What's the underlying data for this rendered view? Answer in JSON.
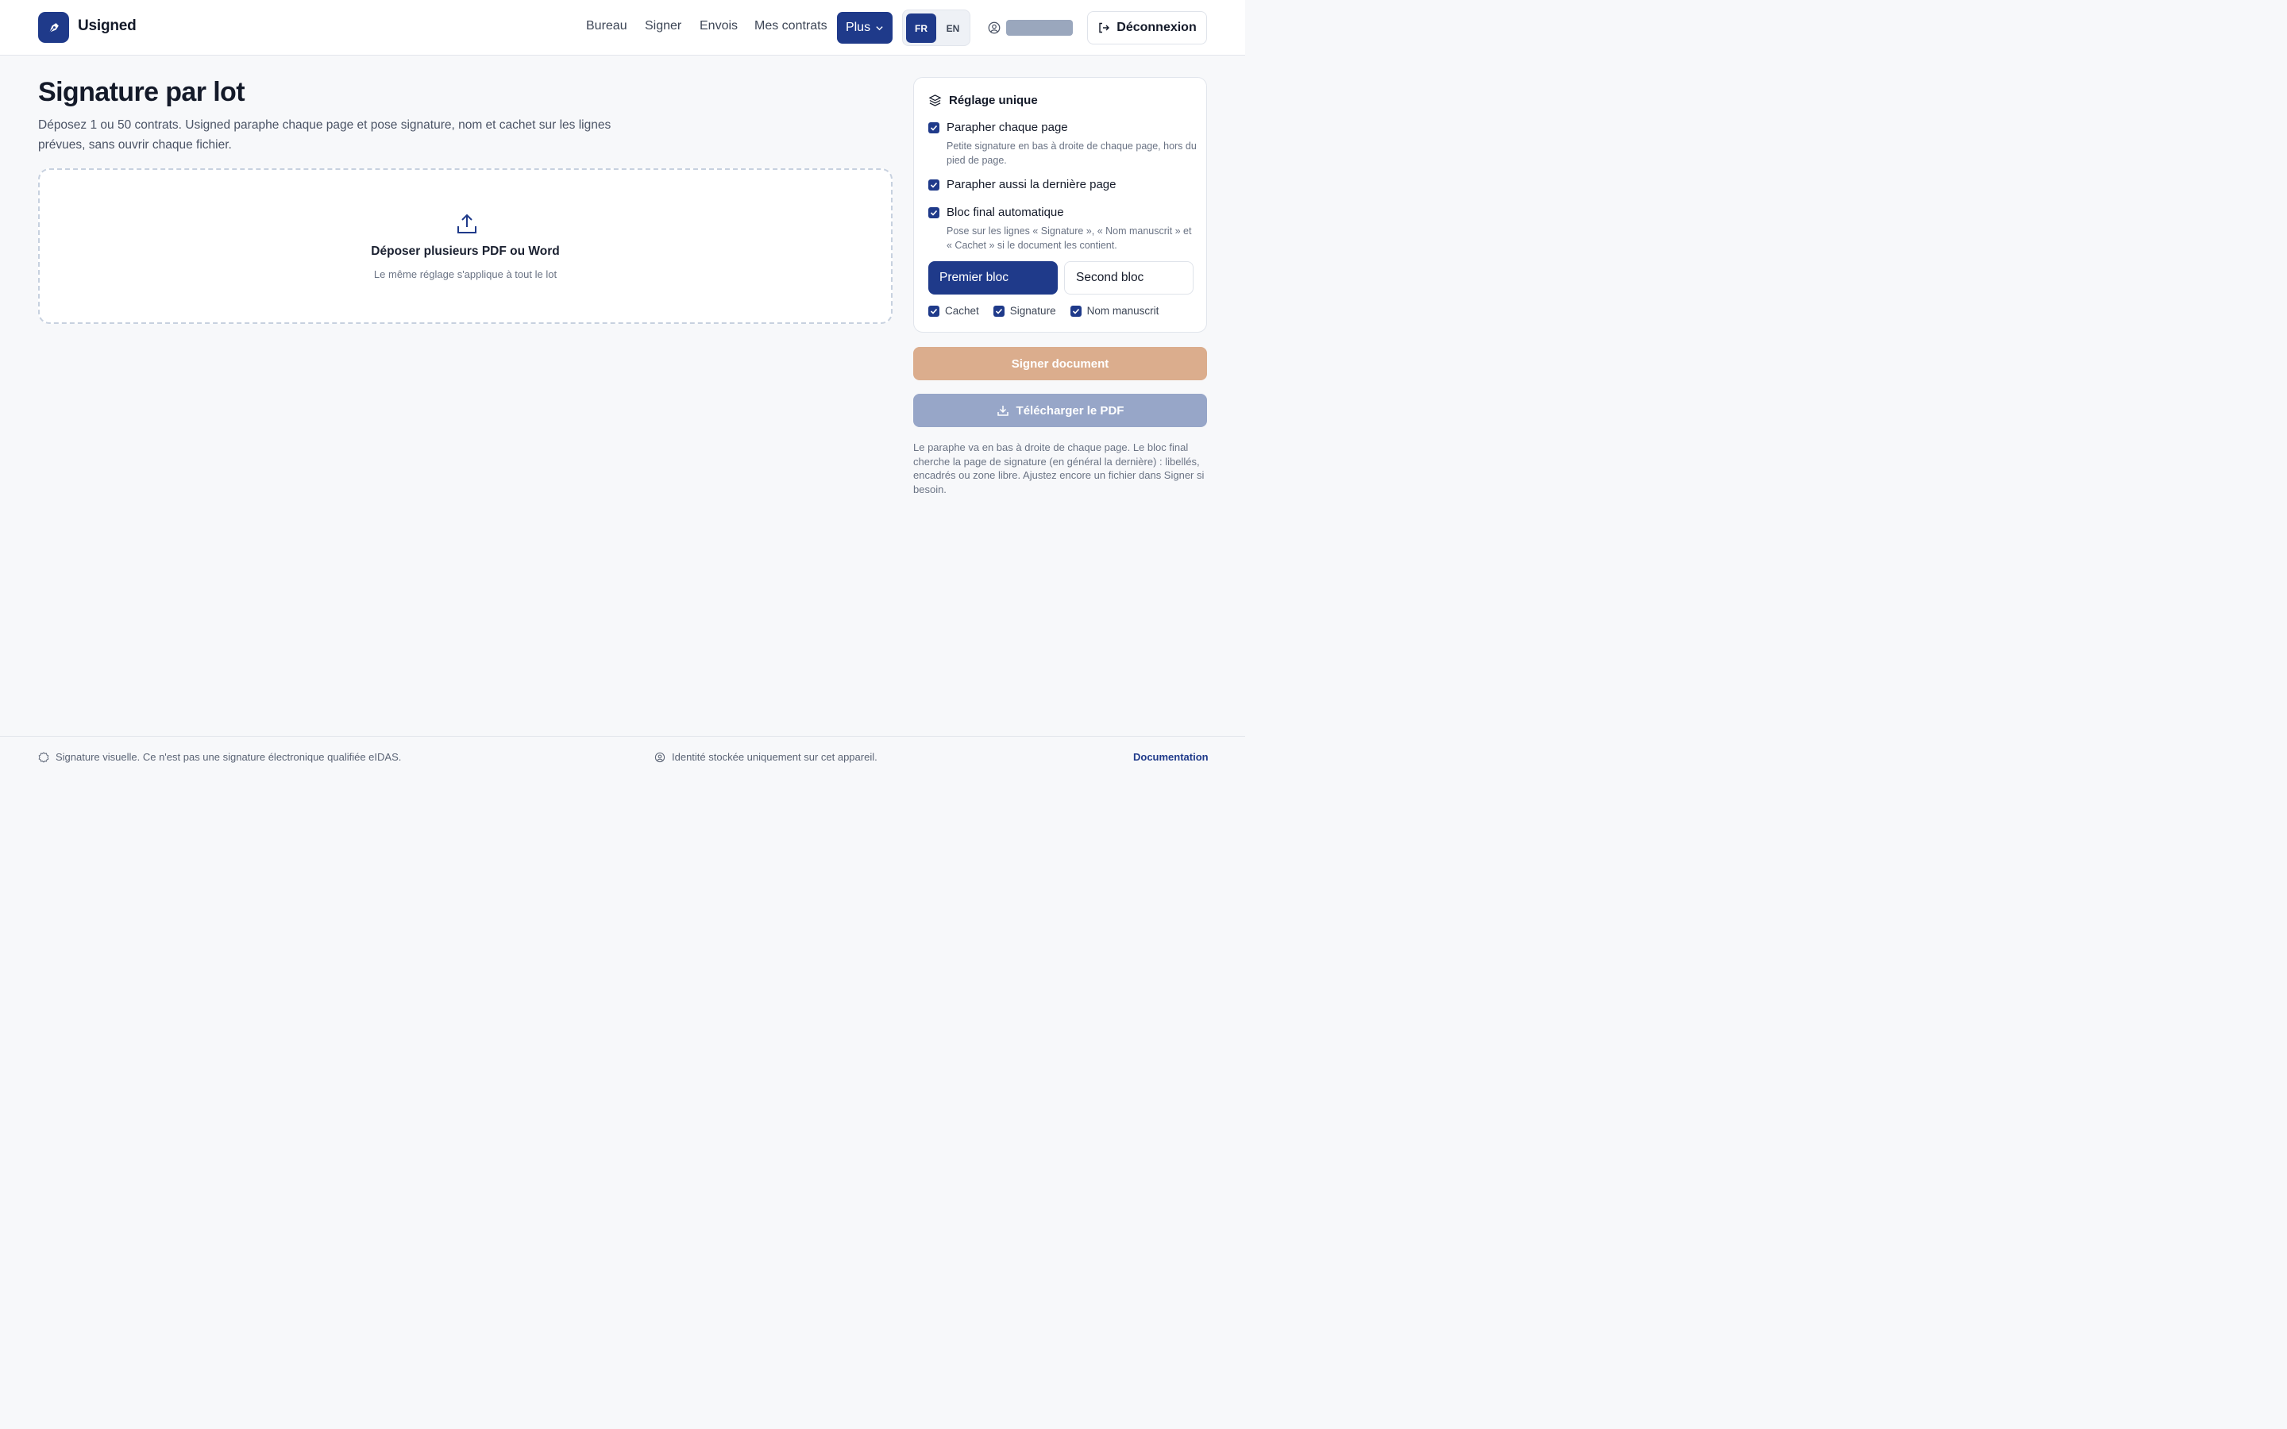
{
  "header": {
    "brand": "Usigned",
    "nav": [
      "Bureau",
      "Signer",
      "Envois",
      "Mes contrats"
    ],
    "more_label": "Plus",
    "lang": {
      "fr": "FR",
      "en": "EN",
      "active": "FR"
    },
    "logout_label": "Déconnexion"
  },
  "main": {
    "title": "Signature par lot",
    "description": "Déposez 1 ou 50 contrats. Usigned paraphe chaque page et pose signature, nom et cachet sur les lignes prévues, sans ouvrir chaque fichier.",
    "dropzone": {
      "title": "Déposer plusieurs PDF ou Word",
      "subtitle": "Le même réglage s'applique à tout le lot"
    }
  },
  "settings": {
    "title": "Réglage unique",
    "options": [
      {
        "label": "Parapher chaque page",
        "checked": true,
        "help": "Petite signature en bas à droite de chaque page, hors du pied de page."
      },
      {
        "label": "Parapher aussi la dernière page",
        "checked": true,
        "help": ""
      },
      {
        "label": "Bloc final automatique",
        "checked": true,
        "help": "Pose sur les lignes « Signature », « Nom manuscrit » et « Cachet » si le document les contient."
      }
    ],
    "blocks": {
      "first": "Premier bloc",
      "second": "Second bloc",
      "active": "first"
    },
    "elements": [
      {
        "label": "Cachet",
        "checked": true
      },
      {
        "label": "Signature",
        "checked": true
      },
      {
        "label": "Nom manuscrit",
        "checked": true
      }
    ]
  },
  "actions": {
    "sign_label": "Signer document",
    "download_label": "Télécharger le PDF",
    "note": "Le paraphe va en bas à droite de chaque page. Le bloc final cherche la page de signature (en général la dernière) : libellés, encadrés ou zone libre. Ajustez encore un fichier dans Signer si besoin."
  },
  "footer": {
    "disclaimer": "Signature visuelle. Ce n'est pas une signature électronique qualifiée eIDAS.",
    "privacy": "Identité stockée uniquement sur cet appareil.",
    "docs_link": "Documentation"
  },
  "colors": {
    "primary": "#1f3a8a",
    "sign_button": "#dbad8d",
    "download_button": "#97a6c8",
    "background": "#f7f8fa"
  },
  "icons": {
    "logo": "pen-nib-icon",
    "upload": "upload-icon",
    "settings": "layers-icon",
    "user": "user-circle-icon",
    "logout": "logout-icon",
    "download": "download-icon"
  }
}
